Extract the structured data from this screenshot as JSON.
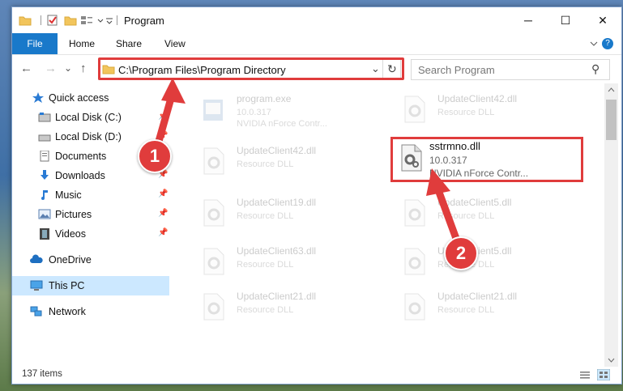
{
  "window": {
    "title": "Program",
    "minimize_glyph": "─",
    "maximize_glyph": "☐",
    "close_glyph": "✕"
  },
  "ribbon": {
    "tabs": [
      "File",
      "Home",
      "Share",
      "View"
    ],
    "help_glyph": "?"
  },
  "nav": {
    "back_glyph": "←",
    "forward_glyph": "→",
    "recent_glyph": "⌄",
    "up_glyph": "↑",
    "address": "C:\\Program Files\\Program Directory",
    "address_dropdown_glyph": "⌄",
    "refresh_glyph": "↻",
    "search_placeholder": "Search Program",
    "search_glyph": "⚲"
  },
  "sidebar": {
    "items": [
      {
        "label": "Quick access",
        "icon": "star-icon",
        "pinned": false
      },
      {
        "label": "Local Disk (C:)",
        "icon": "drive-icon",
        "pinned": true
      },
      {
        "label": "Local Disk (D:)",
        "icon": "drive-icon",
        "pinned": true
      },
      {
        "label": "Documents",
        "icon": "documents-icon",
        "pinned": true
      },
      {
        "label": "Downloads",
        "icon": "downloads-icon",
        "pinned": true
      },
      {
        "label": "Music",
        "icon": "music-icon",
        "pinned": true
      },
      {
        "label": "Pictures",
        "icon": "pictures-icon",
        "pinned": true
      },
      {
        "label": "Videos",
        "icon": "videos-icon",
        "pinned": true
      },
      {
        "label": "OneDrive",
        "icon": "cloud-icon",
        "pinned": false
      },
      {
        "label": "This PC",
        "icon": "computer-icon",
        "pinned": false,
        "selected": true
      },
      {
        "label": "Network",
        "icon": "network-icon",
        "pinned": false
      }
    ],
    "pin_glyph": "📌"
  },
  "files": [
    {
      "name": "program.exe",
      "sub": "10.0.317",
      "sub2": "NVIDIA nForce Contr..."
    },
    {
      "name": "UpdateClient42.dll",
      "sub": "Resource DLL"
    },
    {
      "name": "UpdateClient42.dll",
      "sub": "Resource DLL"
    },
    {
      "name": "UpdateClient19.dll",
      "sub": "Resource DLL"
    },
    {
      "name": "UpdateClient5.dll",
      "sub": "Resource DLL"
    },
    {
      "name": "UpdateClient63.dll",
      "sub": "Resource DLL"
    },
    {
      "name": "UpdateClient5.dll",
      "sub": "Resource DLL"
    },
    {
      "name": "UpdateClient21.dll",
      "sub": "Resource DLL"
    },
    {
      "name": "UpdateClient21.dll",
      "sub": "Resource DLL"
    }
  ],
  "highlighted_file": {
    "name": "sstrmno.dll",
    "version": "10.0.317",
    "description": "NVIDIA nForce Contr..."
  },
  "status": {
    "count": "137 items"
  },
  "callouts": [
    "1",
    "2"
  ],
  "colors": {
    "accent": "#1979ca",
    "highlight": "#e03c3c",
    "selected_row": "#cce8ff"
  }
}
